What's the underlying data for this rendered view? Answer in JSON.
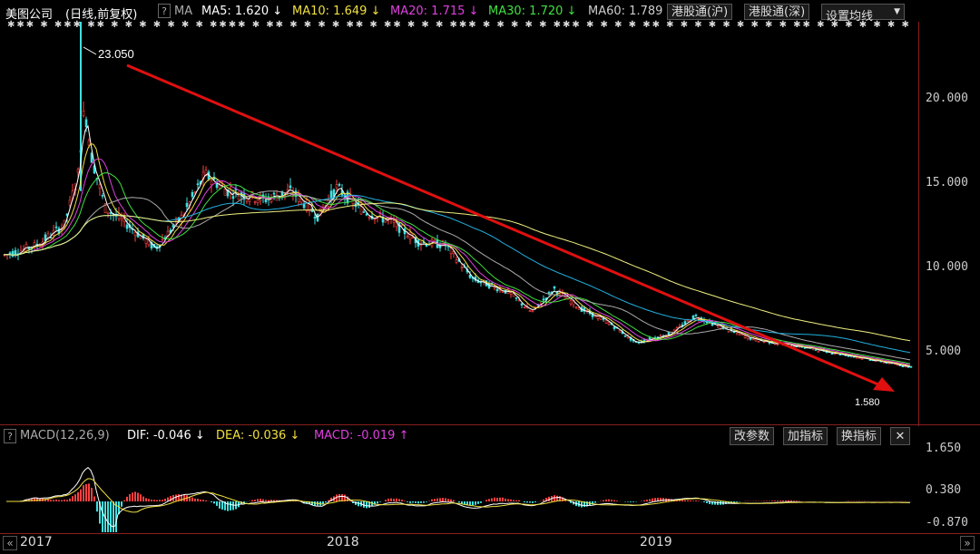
{
  "header": {
    "stock_name": "美图公司",
    "chart_mode": "(日线,前复权)",
    "help": "?",
    "indicator": "MA",
    "ma": [
      {
        "label": "MA5:",
        "value": "1.620",
        "arrow": "↓",
        "color": "#ffffff"
      },
      {
        "label": "MA10:",
        "value": "1.649",
        "arrow": "↓",
        "color": "#f0e040"
      },
      {
        "label": "MA20:",
        "value": "1.715",
        "arrow": "↓",
        "color": "#e040e0"
      },
      {
        "label": "MA30:",
        "value": "1.720",
        "arrow": "↓",
        "color": "#40e040"
      },
      {
        "label": "MA60:",
        "value": "1.789",
        "color": "#cccccc"
      }
    ],
    "buttons": {
      "sh_connect": "港股通(沪)",
      "sz_connect": "港股通(深)",
      "set_ma": "设置均线"
    }
  },
  "price_panel": {
    "peak_label": "23.050",
    "last_label": "1.580",
    "y_ticks": [
      "20.000",
      "15.000",
      "10.000",
      "5.000"
    ]
  },
  "macd_panel": {
    "help": "?",
    "title": "MACD(12,26,9)",
    "dif": {
      "label": "DIF:",
      "value": "-0.046",
      "arrow": "↓"
    },
    "dea": {
      "label": "DEA:",
      "value": "-0.036",
      "arrow": "↓"
    },
    "macd": {
      "label": "MACD:",
      "value": "-0.019",
      "arrow": "↑"
    },
    "buttons": {
      "params": "改参数",
      "add": "加指标",
      "switch": "换指标",
      "close": "✕"
    },
    "y_ticks": [
      "1.650",
      "0.380",
      "-0.870"
    ]
  },
  "x_axis": {
    "labels": [
      "2017",
      "2018",
      "2019"
    ],
    "prev": "«",
    "next": "»"
  },
  "colors": {
    "up": "#ff4040",
    "down": "#40e0e0",
    "trend_arrow": "#e01010",
    "ma60": "#f0f080",
    "ma120": "#20b0e0"
  }
}
